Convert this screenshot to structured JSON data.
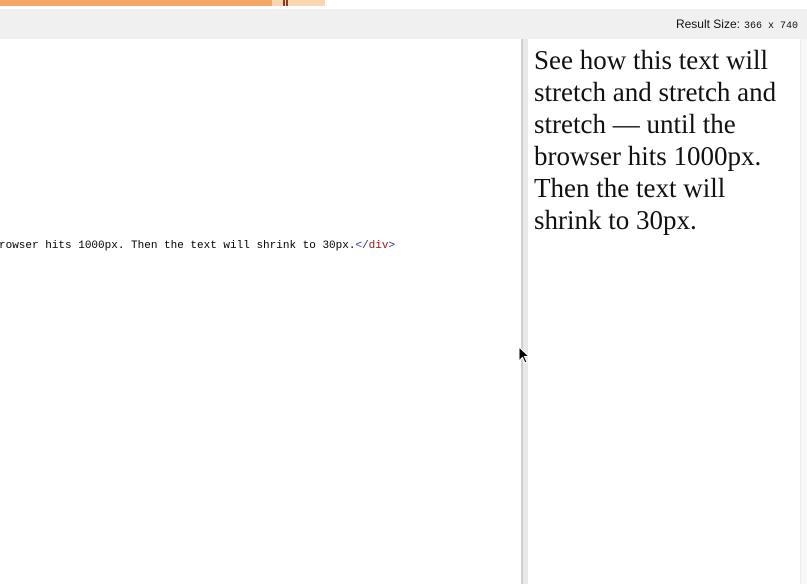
{
  "result_bar": {
    "label": "Result Size:",
    "dims": "366 x 740"
  },
  "code": {
    "line_text": "rowser hits 1000px. Then the text will shrink to 30px.",
    "close_open": "</",
    "close_tagname": "div",
    "close_end": ">"
  },
  "result": {
    "text": "See how this text will stretch and stretch and stretch — until the browser hits 1000px. Then the text will shrink to 30px."
  },
  "colors": {
    "top_bar": "#f5a768",
    "result_bar_bg": "#f0f0f0",
    "tag_bracket": "#2a2aa8",
    "tag_name": "#a31515"
  },
  "icons": {
    "cursor": "mouse-pointer-icon"
  }
}
